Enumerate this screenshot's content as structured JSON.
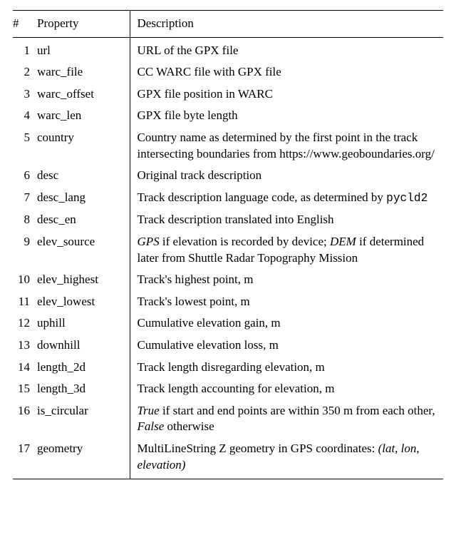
{
  "headers": {
    "num": "#",
    "property": "Property",
    "description": "Description"
  },
  "rows": [
    {
      "n": "1",
      "prop": "url",
      "desc": "URL of the GPX file"
    },
    {
      "n": "2",
      "prop": "warc_file",
      "desc": "CC WARC file with GPX file"
    },
    {
      "n": "3",
      "prop": "warc_offset",
      "desc": "GPX file position in WARC"
    },
    {
      "n": "4",
      "prop": "warc_len",
      "desc": "GPX file byte length"
    },
    {
      "n": "5",
      "prop": "country",
      "desc": "Country name as determined by the first point in the track intersecting boundaries from https://www.geoboundaries.org/"
    },
    {
      "n": "6",
      "prop": "desc",
      "desc": "Original track description"
    },
    {
      "n": "7",
      "prop": "desc_lang",
      "desc_html": "Track description language code, as determined by <span class=\"mono\">pycld2</span>"
    },
    {
      "n": "8",
      "prop": "desc_en",
      "desc": "Track description translated into English"
    },
    {
      "n": "9",
      "prop": "elev_source",
      "desc_html": "<em>GPS</em> if elevation is recorded by device; <em>DEM</em> if determined later from Shuttle Radar Topography Mission"
    },
    {
      "n": "10",
      "prop": "elev_highest",
      "desc": "Track's highest point, m"
    },
    {
      "n": "11",
      "prop": "elev_lowest",
      "desc": "Track's lowest point, m"
    },
    {
      "n": "12",
      "prop": "uphill",
      "desc": "Cumulative elevation gain, m"
    },
    {
      "n": "13",
      "prop": "downhill",
      "desc": "Cumulative elevation loss, m"
    },
    {
      "n": "14",
      "prop": "length_2d",
      "desc": "Track length disregarding elevation, m"
    },
    {
      "n": "15",
      "prop": "length_3d",
      "desc": "Track length accounting for elevation, m"
    },
    {
      "n": "16",
      "prop": "is_circular",
      "desc_html": "<em>True</em> if start and end points are within 350 m from each other, <em>False</em> otherwise"
    },
    {
      "n": "17",
      "prop": "geometry",
      "desc_html": "MultiLineString Z geometry in GPS coordinates: <em>(lat, lon, elevation)</em>"
    }
  ]
}
